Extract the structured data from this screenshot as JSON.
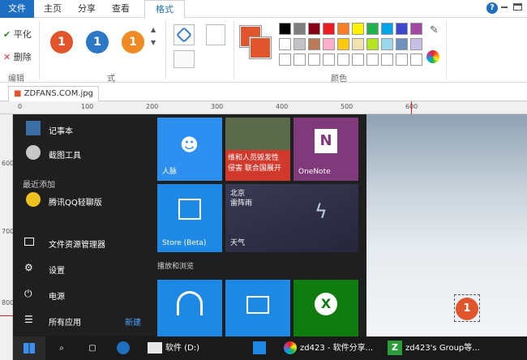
{
  "ribbon_tabs": [
    "文件",
    "主页",
    "分享",
    "查看",
    "格式"
  ],
  "ribbon": {
    "smooth_label": "平化",
    "delete_label": "删除",
    "edit_group": "编辑",
    "styles_group": "式",
    "color_group": "颜色",
    "style_numbers": [
      "1",
      "1",
      "1"
    ]
  },
  "palette_colors": [
    "#000000",
    "#7f7f7f",
    "#880015",
    "#ed1c24",
    "#ff7f27",
    "#fff200",
    "#22b14c",
    "#00a2e8",
    "#3f48cc",
    "#a349a4",
    "#ffffff",
    "#c3c3c3",
    "#b97a57",
    "#ffaec9",
    "#ffc90e",
    "#efe4b0",
    "#b5e61d",
    "#99d9ea",
    "#7092be",
    "#c8bfe7"
  ],
  "document": {
    "tab_label": "ZDFANS.COM.jpg",
    "hruler_labels": [
      "0",
      "100",
      "200",
      "300",
      "400",
      "500",
      "600"
    ],
    "vruler_labels": [
      "600",
      "700",
      "800"
    ]
  },
  "startmenu": {
    "items": {
      "notepad": "记事本",
      "snip": "截图工具",
      "recent_header": "最近添加",
      "qq": "腾讯QQ轻聊版",
      "explorer": "文件资源管理器",
      "settings": "设置",
      "power": "电源",
      "allapps": "所有应用",
      "new_badge": "新建"
    },
    "tiles": {
      "people": "人脉",
      "news_line1": "维和人员毁发性",
      "news_line2": "侵害 联合国展开",
      "onenote": "OneNote",
      "weather_city": "北京",
      "weather_cond": "雷阵雨",
      "weather": "天气",
      "store": "Store (Beta)",
      "section": "播放和浏览"
    }
  },
  "canvas_marker": "1",
  "taskbar": {
    "drive": "软件 (D:)",
    "chrome": "zd423 - 软件分享...",
    "group": "zd423's Group等..."
  },
  "colors": {
    "accent": "#1e6fc2",
    "tile_blue": "#1e88e5",
    "onenote": "#80397b",
    "xbox": "#107c10",
    "marker": "#e0552b"
  }
}
